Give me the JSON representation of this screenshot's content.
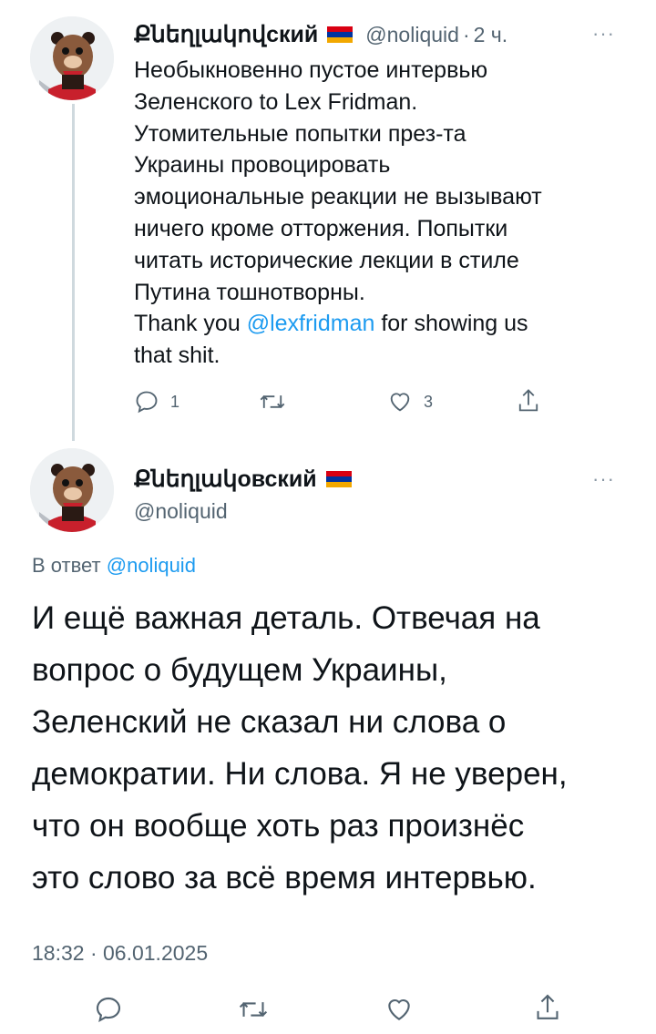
{
  "colors": {
    "accent": "#1d9bf0",
    "text": "#0f1419",
    "muted": "#536471",
    "divider": "#cfd9de"
  },
  "tweet1": {
    "display_name": "Քնեղլակովский",
    "handle": "@noliquid",
    "separator": "·",
    "time": "2 ч.",
    "more_label": "···",
    "flag_icon": "armenia-flag-icon",
    "lines": [
      "Необыкновенно пустое интервью",
      "Зеленского to Lex Fridman.",
      "Утомительные попытки през-та",
      "Украины провоцировать",
      "эмоциональные реакции не вызывают",
      "ничего кроме отторжения. Попытки",
      "читать исторические лекции в стиле",
      "Путина тошнотворны."
    ],
    "thanks_prefix": "Thank you ",
    "mention": "@lexfridman",
    "thanks_suffix": " for showing us",
    "last_line": "that shit.",
    "actions": {
      "reply_count": "1",
      "like_count": "3"
    }
  },
  "tweet2": {
    "display_name": "Քնեղլակовский",
    "handle": "@noliquid",
    "more_label": "···",
    "reply_prefix": "В ответ ",
    "reply_to": "@noliquid",
    "lines": [
      "И ещё важная деталь. Отвечая на",
      "вопрос о будущем Украины,",
      "Зеленский не сказал ни слова о",
      "демократии. Ни слова. Я не уверен,",
      "что он вообще хоть раз произнёс",
      "это слово за всё время интервью."
    ],
    "timestamp": "18:32 · 06.01.2025"
  }
}
